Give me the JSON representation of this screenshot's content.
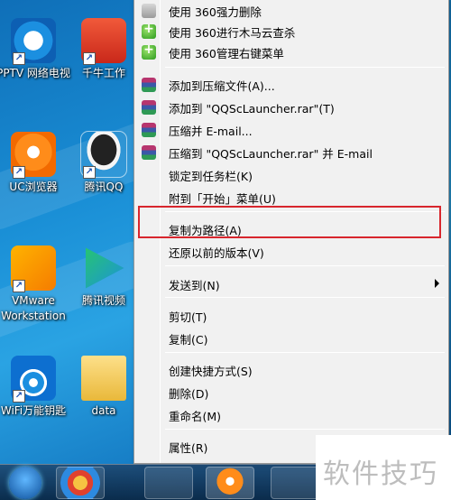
{
  "desktop": {
    "icons": [
      {
        "label": "PPTV 网络电视"
      },
      {
        "label": "千牛工作"
      },
      {
        "label": "UC浏览器"
      },
      {
        "label": "腾讯QQ"
      },
      {
        "label": "VMware Workstation"
      },
      {
        "label": "腾讯视频"
      },
      {
        "label": "WiFi万能钥匙"
      },
      {
        "label": "data"
      }
    ]
  },
  "menu": {
    "items": [
      {
        "label": "使用 360强力删除",
        "icon": "shred-icon"
      },
      {
        "label": "使用 360进行木马云查杀",
        "icon": "360-icon"
      },
      {
        "label": "使用 360管理右键菜单",
        "icon": "360-icon"
      },
      {
        "label": "添加到压缩文件(A)...",
        "icon": "winrar-icon"
      },
      {
        "label": "添加到 \"QQScLauncher.rar\"(T)",
        "icon": "winrar-icon"
      },
      {
        "label": "压缩并 E-mail...",
        "icon": "winrar-icon"
      },
      {
        "label": "压缩到 \"QQScLauncher.rar\" 并 E-mail",
        "icon": "winrar-icon"
      },
      {
        "label": "锁定到任务栏(K)"
      },
      {
        "label": "附到「开始」菜单(U)"
      },
      {
        "label": "复制为路径(A)"
      },
      {
        "label": "还原以前的版本(V)"
      },
      {
        "label": "发送到(N)"
      },
      {
        "label": "剪切(T)"
      },
      {
        "label": "复制(C)"
      },
      {
        "label": "创建快捷方式(S)"
      },
      {
        "label": "删除(D)"
      },
      {
        "label": "重命名(M)"
      },
      {
        "label": "属性(R)"
      }
    ],
    "highlight_color": "#d8262d"
  },
  "watermark": "软件技巧"
}
